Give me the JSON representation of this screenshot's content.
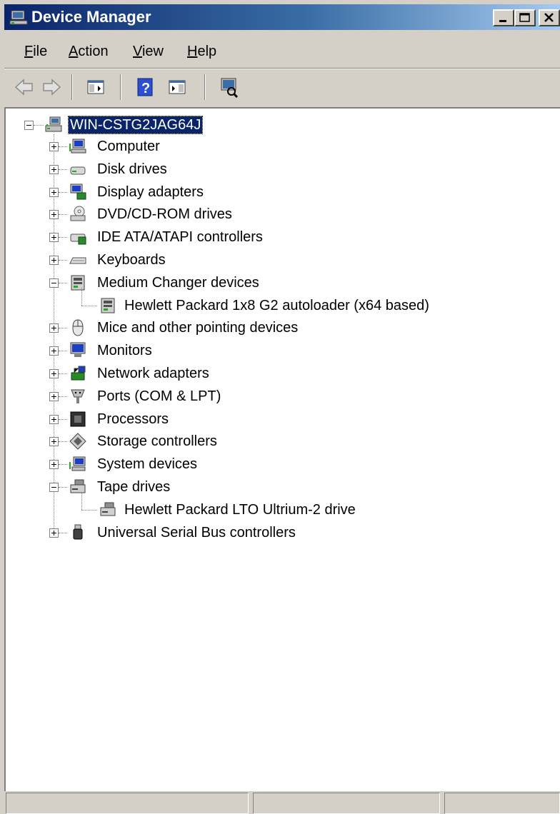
{
  "window": {
    "title": "Device Manager"
  },
  "menu": {
    "file": "File",
    "action": "Action",
    "view": "View",
    "help": "Help",
    "file_mnemonic": "F",
    "action_mnemonic": "A",
    "view_mnemonic": "V",
    "help_mnemonic": "H",
    "file_rest": "ile",
    "action_rest": "ction",
    "view_rest": "iew",
    "help_rest": "elp"
  },
  "toolbar": {
    "buttons": [
      "back-icon",
      "forward-icon",
      "show-hide-console-tree-icon",
      "help-icon",
      "action-pane-icon",
      "scan-hardware-icon"
    ]
  },
  "tree": {
    "root": {
      "label": "WIN-CSTG2JAG64J",
      "selected": true,
      "expanded": true
    },
    "items": [
      {
        "label": "Computer",
        "icon": "computer-icon",
        "expanded": false
      },
      {
        "label": "Disk drives",
        "icon": "disk-drive-icon",
        "expanded": false
      },
      {
        "label": "Display adapters",
        "icon": "display-adapter-icon",
        "expanded": false
      },
      {
        "label": "DVD/CD-ROM drives",
        "icon": "dvd-drive-icon",
        "expanded": false
      },
      {
        "label": "IDE ATA/ATAPI controllers",
        "icon": "ide-controller-icon",
        "expanded": false
      },
      {
        "label": "Keyboards",
        "icon": "keyboard-icon",
        "expanded": false
      },
      {
        "label": "Medium Changer devices",
        "icon": "medium-changer-icon",
        "expanded": true,
        "children": [
          {
            "label": "Hewlett Packard 1x8 G2 autoloader  (x64 based)",
            "icon": "medium-changer-icon"
          }
        ]
      },
      {
        "label": "Mice and other pointing devices",
        "icon": "mouse-icon",
        "expanded": false
      },
      {
        "label": "Monitors",
        "icon": "monitor-icon",
        "expanded": false
      },
      {
        "label": "Network adapters",
        "icon": "network-adapter-icon",
        "expanded": false
      },
      {
        "label": "Ports (COM & LPT)",
        "icon": "port-icon",
        "expanded": false
      },
      {
        "label": "Processors",
        "icon": "processor-icon",
        "expanded": false
      },
      {
        "label": "Storage controllers",
        "icon": "storage-controller-icon",
        "expanded": false
      },
      {
        "label": "System devices",
        "icon": "system-devices-icon",
        "expanded": false
      },
      {
        "label": "Tape drives",
        "icon": "tape-drive-icon",
        "expanded": true,
        "children": [
          {
            "label": "Hewlett Packard LTO Ultrium-2 drive",
            "icon": "tape-drive-icon"
          }
        ]
      },
      {
        "label": "Universal Serial Bus controllers",
        "icon": "usb-icon",
        "expanded": false
      }
    ]
  },
  "statusbar": {
    "panels": [
      "",
      "",
      ""
    ]
  },
  "colors": {
    "titlebar_start": "#0a246a",
    "titlebar_end": "#a6caf0",
    "selection": "#0a246a",
    "face": "#d4d0c8"
  }
}
